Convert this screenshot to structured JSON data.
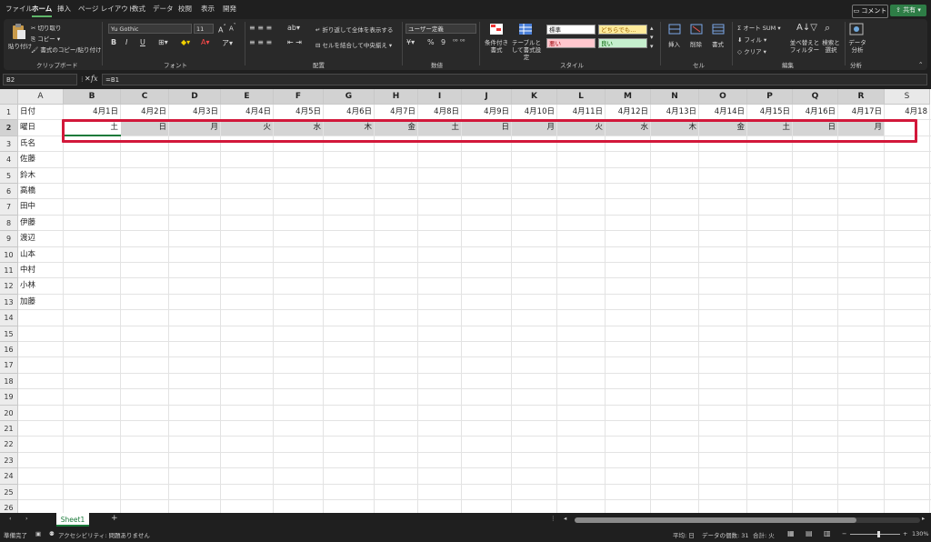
{
  "menu": {
    "tabs": [
      "ファイル",
      "ホーム",
      "挿入",
      "ページ レイアウト",
      "数式",
      "データ",
      "校閲",
      "表示",
      "開発"
    ],
    "active_index": 1,
    "comment_button": "コメント",
    "share_button": "共有"
  },
  "ribbon": {
    "clipboard": {
      "paste": "貼り付け",
      "cut": "切り取り",
      "copy": "コピー",
      "format_painter": "書式のコピー/貼り付け",
      "label": "クリップボード"
    },
    "font": {
      "font_name": "Yu Gothic",
      "font_size": "11",
      "bold": "B",
      "italic": "I",
      "underline": "U",
      "label": "フォント"
    },
    "alignment": {
      "wrap": "折り返して全体を表示する",
      "merge": "セルを結合して中央揃え",
      "label": "配置"
    },
    "number": {
      "format": "ユーザー定義",
      "percent": "%",
      "comma": "9",
      "label": "数値"
    },
    "styles": {
      "conditional": "条件付き書式",
      "table": "テーブルとして書式設定",
      "normal": "標準",
      "neutral": "どちらでも...",
      "bad": "悪い",
      "good": "良い",
      "label": "スタイル"
    },
    "cells": {
      "insert": "挿入",
      "delete": "削除",
      "format": "書式",
      "label": "セル"
    },
    "editing": {
      "autosum": "オート SUM",
      "fill": "フィル",
      "clear": "クリア",
      "sort": "並べ替えとフィルター",
      "find": "検索と選択",
      "label": "編集"
    },
    "analysis": {
      "analyze": "データ分析",
      "label": "分析"
    }
  },
  "formula_bar": {
    "name_box": "B2",
    "fx": "fx",
    "formula": "=B1"
  },
  "grid": {
    "columns": [
      "A",
      "B",
      "C",
      "D",
      "E",
      "F",
      "G",
      "H",
      "I",
      "J",
      "K",
      "L",
      "M",
      "N",
      "O",
      "P",
      "Q",
      "R",
      "S"
    ],
    "rows": [
      "1",
      "2",
      "3",
      "4",
      "5",
      "6",
      "7",
      "8",
      "9",
      "10",
      "11",
      "12",
      "13",
      "14",
      "15",
      "16",
      "17",
      "18",
      "19",
      "20",
      "21",
      "22",
      "23",
      "24",
      "25",
      "26"
    ],
    "col_a": [
      "日付",
      "曜日",
      "氏名",
      "佐藤",
      "鈴木",
      "高橋",
      "田中",
      "伊藤",
      "渡辺",
      "山本",
      "中村",
      "小林",
      "加藤"
    ],
    "row1_dates": [
      "4月1日",
      "4月2日",
      "4月3日",
      "4月4日",
      "4月5日",
      "4月6日",
      "4月7日",
      "4月8日",
      "4月9日",
      "4月10日",
      "4月11日",
      "4月12日",
      "4月13日",
      "4月14日",
      "4月15日",
      "4月16日",
      "4月17日",
      "4月18"
    ],
    "row2_days": [
      "土",
      "日",
      "月",
      "火",
      "水",
      "木",
      "金",
      "土",
      "日",
      "月",
      "火",
      "水",
      "木",
      "金",
      "土",
      "日",
      "月"
    ]
  },
  "sheet_tabs": {
    "active": "Sheet1",
    "add": "+"
  },
  "status": {
    "ready": "準備完了",
    "accessibility": "アクセシビリティ: 問題ありません",
    "average": "平均: 日",
    "count": "データの個数: 31",
    "sum": "合計: 火",
    "zoom": "130%"
  }
}
